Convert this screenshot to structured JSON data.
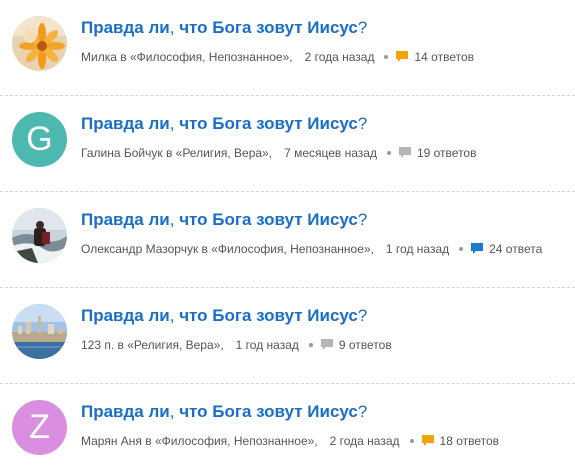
{
  "colors": {
    "title": "#1a6fc4",
    "meta_text": "#555555",
    "bubble_orange": "#f0a500",
    "bubble_gray": "#b5b5b5",
    "bubble_blue": "#1a7ad4",
    "avatar_teal": "#4cb8b0",
    "avatar_purple": "#d98ee0"
  },
  "questions": [
    {
      "title_part1": "Правда ли",
      "title_part2": " что Бога зовут Иисус",
      "author": "Милка",
      "category_text": "в «Философия, Непознанное»,",
      "time": "2 года назад",
      "answers": "14 ответов",
      "bubble_icon": "speech-bubble-icon",
      "bubble_color": "#f0a500",
      "avatar_type": "photo-flower"
    },
    {
      "title_part1": "Правда ли",
      "title_part2": " что Бога зовут Иисус",
      "author": "Галина Бойчук",
      "category_text": "в «Религия, Вера»,",
      "time": "7 месяцев назад",
      "answers": "19 ответов",
      "bubble_icon": "speech-bubble-icon",
      "bubble_color": "#b5b5b5",
      "avatar_type": "letter",
      "avatar_letter": "G"
    },
    {
      "title_part1": "Правда ли",
      "title_part2": " что Бога зовут Иисус",
      "author": "Олександр Мазорчук",
      "category_text": "в «Философия, Непознанное»,",
      "time": "1 год назад",
      "answers": "24 ответа",
      "bubble_icon": "speech-bubble-icon",
      "bubble_color": "#1a7ad4",
      "avatar_type": "photo-river"
    },
    {
      "title_part1": "Правда ли",
      "title_part2": " что Бога зовут Иисус",
      "author": "123 п.",
      "category_text": "в «Религия, Вера»,",
      "time": "1 год назад",
      "answers": "9 ответов",
      "bubble_icon": "speech-bubble-icon",
      "bubble_color": "#b5b5b5",
      "avatar_type": "photo-city"
    },
    {
      "title_part1": "Правда ли",
      "title_part2": " что Бога зовут Иисус",
      "author": "Марян Аня",
      "category_text": "в «Философия, Непознанное»,",
      "time": "2 года назад",
      "answers": "18 ответов",
      "bubble_icon": "speech-bubble-icon",
      "bubble_color": "#f0a500",
      "avatar_type": "letter",
      "avatar_letter": "Z"
    }
  ]
}
